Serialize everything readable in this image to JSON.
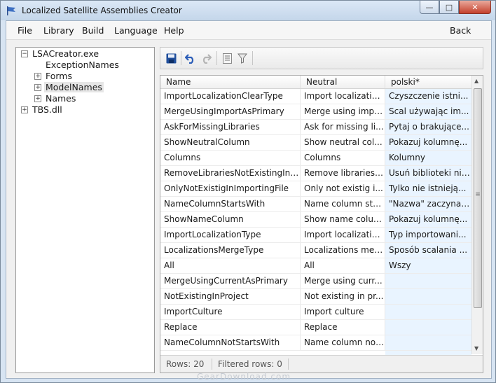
{
  "window": {
    "title": "Localized Satellite Assemblies Creator",
    "controls": {
      "minimize": "—",
      "maximize": "□",
      "close": "✕"
    }
  },
  "menu": {
    "items": [
      "File",
      "Library",
      "Build",
      "Language",
      "Help"
    ],
    "back": "Back"
  },
  "tree": {
    "root": "LSACreator.exe",
    "children": [
      "ExceptionNames",
      "Forms",
      "ModelNames",
      "Names"
    ],
    "selected": "ModelNames",
    "root2": "TBS.dll"
  },
  "toolbar": {
    "icons": [
      "save-icon",
      "undo-icon",
      "redo-icon",
      "columns-icon",
      "filter-icon"
    ]
  },
  "grid": {
    "headers": [
      "Name",
      "Neutral",
      "polski*"
    ],
    "rows": [
      [
        "ImportLocalizationClearType",
        "Import localizatio...",
        "Czyszczenie istni..."
      ],
      [
        "MergeUsingImportAsPrimary",
        "Merge using impo...",
        "Scal używając im..."
      ],
      [
        "AskForMissingLibraries",
        "Ask for missing li...",
        "Pytaj o brakujące..."
      ],
      [
        "ShowNeutralColumn",
        "Show neutral col...",
        "Pokazuj kolumnę..."
      ],
      [
        "Columns",
        "Columns",
        "Kolumny"
      ],
      [
        "RemoveLibrariesNotExistingInI...",
        "Remove libraries ...",
        "Usuń biblioteki nie..."
      ],
      [
        "OnlyNotExistigInImportingFile",
        "Only not existig i...",
        "Tylko nie istnieją..."
      ],
      [
        "NameColumnStartsWith",
        "Name column sta...",
        "\"Nazwa\" zaczyna ..."
      ],
      [
        "ShowNameColumn",
        "Show name column",
        "Pokazuj kolumnę..."
      ],
      [
        "ImportLocalizationType",
        "Import localizatio...",
        "Typ importowani..."
      ],
      [
        "LocalizationsMergeType",
        "Localizations mer...",
        "Sposób scalania ..."
      ],
      [
        "All",
        "All",
        "Wszy"
      ],
      [
        "MergeUsingCurrentAsPrimary",
        "Merge using curr...",
        ""
      ],
      [
        "NotExistingInProject",
        "Not existing in pr...",
        ""
      ],
      [
        "ImportCulture",
        "Import culture",
        ""
      ],
      [
        "Replace",
        "Replace",
        ""
      ],
      [
        "NameColumnNotStartsWith",
        "Name column not...",
        ""
      ]
    ],
    "scroll_grip": "≡"
  },
  "status": {
    "rows": "Rows:  20",
    "filtered": "Filtered rows:  0"
  },
  "watermark": "GearDownload.com",
  "colors": {
    "frame": "#d7e4f2",
    "polski_column": "#e9f4ff",
    "close_button": "#c4402c",
    "save_icon": "#1f4e9c",
    "undo_icon": "#2b5db8"
  }
}
